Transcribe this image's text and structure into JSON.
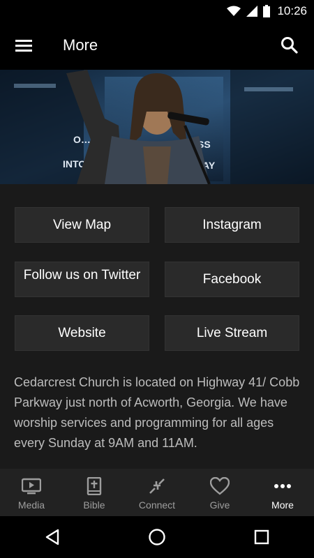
{
  "status_bar": {
    "time": "10:26"
  },
  "app_bar": {
    "title": "More"
  },
  "buttons": [
    {
      "label": "View Map"
    },
    {
      "label": "Instagram"
    },
    {
      "label": "Follow us on Twitter"
    },
    {
      "label": "Facebook"
    },
    {
      "label": "Website"
    },
    {
      "label": "Live Stream"
    }
  ],
  "description": "Cedarcrest Church is located on Highway 41/ Cobb Parkway just north of Acworth, Georgia. We have worship services and programming for all ages every Sunday at 9AM and 11AM.",
  "bottom_nav": {
    "items": [
      {
        "label": "Media",
        "icon": "media-icon"
      },
      {
        "label": "Bible",
        "icon": "bible-icon"
      },
      {
        "label": "Connect",
        "icon": "connect-icon"
      },
      {
        "label": "Give",
        "icon": "heart-icon"
      },
      {
        "label": "More",
        "icon": "more-dots-icon"
      }
    ],
    "active": "More"
  },
  "hero": {
    "banner_text_left": "O…",
    "banner_text_left2": "INTO",
    "banner_text_right": "SS",
    "banner_text_right2": "AY"
  },
  "colors": {
    "background": "#1a1a1a",
    "button": "#2a2a2a",
    "nav_active": "#ffffff",
    "nav_inactive": "#9e9e9e"
  }
}
